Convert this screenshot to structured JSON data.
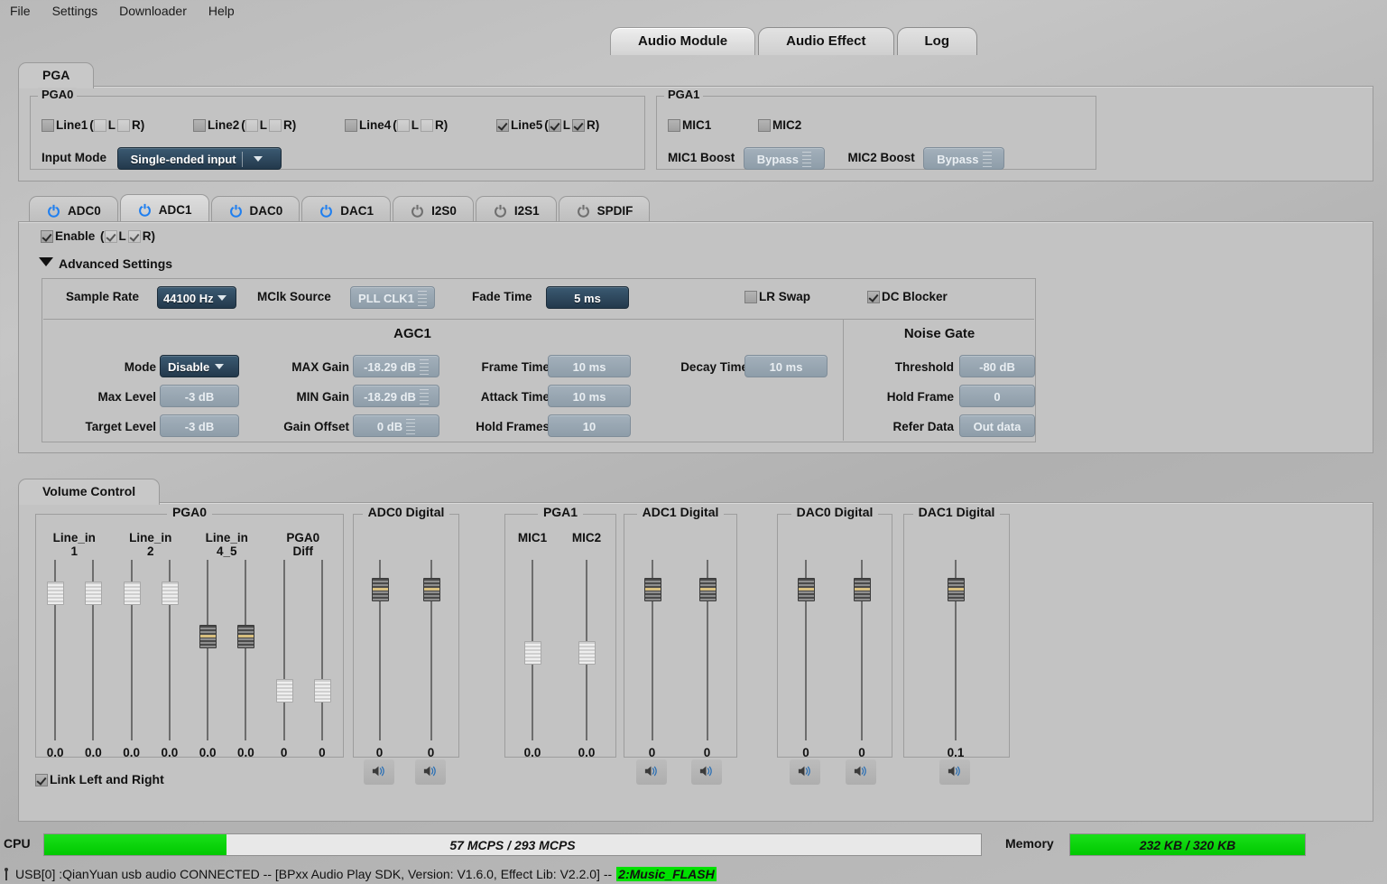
{
  "menubar": {
    "items": [
      "File",
      "Settings",
      "Downloader",
      "Help"
    ]
  },
  "top_tabs": [
    {
      "label": "Audio Module",
      "active": true
    },
    {
      "label": "Audio Effect",
      "active": false
    },
    {
      "label": "Log",
      "active": false
    }
  ],
  "pga_panel": {
    "tab_label": "PGA",
    "pga0": {
      "caption": "PGA0",
      "lines": [
        {
          "label": "Line1",
          "checked": false,
          "enabled": true,
          "l": false,
          "r": false,
          "lr_enabled": false
        },
        {
          "label": "Line2",
          "checked": false,
          "enabled": true,
          "l": false,
          "r": false,
          "lr_enabled": false
        },
        {
          "label": "Line4",
          "checked": false,
          "enabled": true,
          "l": false,
          "r": false,
          "lr_enabled": false
        },
        {
          "label": "Line5",
          "checked": true,
          "enabled": true,
          "l": true,
          "r": true,
          "lr_enabled": true
        }
      ],
      "input_mode_label": "Input Mode",
      "input_mode_value": "Single-ended input"
    },
    "pga1": {
      "caption": "PGA1",
      "mic1_label": "MIC1",
      "mic1_checked": false,
      "mic2_label": "MIC2",
      "mic2_checked": false,
      "mic1_boost_label": "MIC1 Boost",
      "mic1_boost_value": "Bypass",
      "mic2_boost_label": "MIC2 Boost",
      "mic2_boost_value": "Bypass"
    }
  },
  "module_tabs": [
    {
      "label": "ADC0",
      "active": false,
      "power": "on"
    },
    {
      "label": "ADC1",
      "active": true,
      "power": "on"
    },
    {
      "label": "DAC0",
      "active": false,
      "power": "on"
    },
    {
      "label": "DAC1",
      "active": false,
      "power": "on"
    },
    {
      "label": "I2S0",
      "active": false,
      "power": "off"
    },
    {
      "label": "I2S1",
      "active": false,
      "power": "off"
    },
    {
      "label": "SPDIF",
      "active": false,
      "power": "off"
    }
  ],
  "adc1": {
    "enable_label": "Enable",
    "enable_checked": true,
    "l_label": "L",
    "l_checked": true,
    "r_label": "R",
    "r_checked": true,
    "advanced_label": "Advanced Settings",
    "advanced_expanded": true,
    "top_row": {
      "sample_rate_label": "Sample Rate",
      "sample_rate_value": "44100 Hz",
      "mclk_source_label": "MClk Source",
      "mclk_source_value": "PLL CLK1",
      "fade_time_label": "Fade Time",
      "fade_time_value": "5 ms",
      "lr_swap_label": "LR Swap",
      "lr_swap_checked": false,
      "dc_blocker_label": "DC Blocker",
      "dc_blocker_checked": true
    },
    "agc": {
      "title": "AGC1",
      "mode_label": "Mode",
      "mode_value": "Disable",
      "max_level_label": "Max Level",
      "max_level_value": "-3 dB",
      "target_level_label": "Target Level",
      "target_level_value": "-3 dB",
      "max_gain_label": "MAX Gain",
      "max_gain_value": "-18.29 dB",
      "min_gain_label": "MIN Gain",
      "min_gain_value": "-18.29 dB",
      "gain_offset_label": "Gain Offset",
      "gain_offset_value": "0 dB",
      "frame_time_label": "Frame Time",
      "frame_time_value": "10 ms",
      "attack_time_label": "Attack Time",
      "attack_time_value": "10 ms",
      "hold_frames_label": "Hold Frames",
      "hold_frames_value": "10",
      "decay_time_label": "Decay Time",
      "decay_time_value": "10 ms"
    },
    "noise_gate": {
      "title": "Noise Gate",
      "threshold_label": "Threshold",
      "threshold_value": "-80 dB",
      "hold_frame_label": "Hold Frame",
      "hold_frame_value": "0",
      "refer_data_label": "Refer  Data",
      "refer_data_value": "Out data"
    }
  },
  "volume_control": {
    "tab_label": "Volume Control",
    "link_label": "Link Left and Right",
    "link_checked": true,
    "groups": [
      {
        "title": "PGA0",
        "channels": [
          "Line_in 1",
          "Line_in 2",
          "Line_in 4_5",
          "PGA0 Diff"
        ],
        "sliders": [
          {
            "value": "0.0",
            "enabled": false,
            "pos_pct": 12
          },
          {
            "value": "0.0",
            "enabled": false,
            "pos_pct": 12
          },
          {
            "value": "0.0",
            "enabled": false,
            "pos_pct": 12
          },
          {
            "value": "0.0",
            "enabled": false,
            "pos_pct": 12
          },
          {
            "value": "0.0",
            "enabled": true,
            "pos_pct": 36
          },
          {
            "value": "0.0",
            "enabled": true,
            "pos_pct": 36
          },
          {
            "value": "0",
            "enabled": false,
            "pos_pct": 66
          },
          {
            "value": "0",
            "enabled": false,
            "pos_pct": 66
          }
        ],
        "mute_buttons": 0
      },
      {
        "title": "ADC0 Digital",
        "channels": [],
        "sliders": [
          {
            "value": "0",
            "enabled": true,
            "pos_pct": 10
          },
          {
            "value": "0",
            "enabled": true,
            "pos_pct": 10
          }
        ],
        "mute_buttons": 2
      },
      {
        "title": "PGA1",
        "channels": [
          "MIC1",
          "MIC2"
        ],
        "sliders": [
          {
            "value": "0.0",
            "enabled": false,
            "pos_pct": 45
          },
          {
            "value": "0.0",
            "enabled": false,
            "pos_pct": 45
          }
        ],
        "mute_buttons": 0
      },
      {
        "title": "ADC1 Digital",
        "channels": [],
        "sliders": [
          {
            "value": "0",
            "enabled": true,
            "pos_pct": 10
          },
          {
            "value": "0",
            "enabled": true,
            "pos_pct": 10
          }
        ],
        "mute_buttons": 2
      },
      {
        "title": "DAC0 Digital",
        "channels": [],
        "sliders": [
          {
            "value": "0",
            "enabled": true,
            "pos_pct": 10
          },
          {
            "value": "0",
            "enabled": true,
            "pos_pct": 10
          }
        ],
        "mute_buttons": 2
      },
      {
        "title": "DAC1 Digital",
        "channels": [],
        "sliders": [
          {
            "value": "0.1",
            "enabled": true,
            "pos_pct": 10
          }
        ],
        "mute_buttons": 1
      }
    ]
  },
  "footer": {
    "cpu_label": "CPU",
    "cpu_value": "57 MCPS / 293 MCPS",
    "cpu_percent": 19.5,
    "memory_label": "Memory",
    "memory_value": "232 KB / 320 KB",
    "memory_percent": 100,
    "status_text": "USB[0] :QianYuan usb audio CONNECTED -- [BPxx Audio Play SDK,  Version: V1.6.0,  Effect Lib: V2.2.0] --",
    "status_highlight": "2:Music_FLASH"
  },
  "colors": {
    "accent_active_field": "#2d4557",
    "readonly_field": "#97a5b1",
    "power_on": "#1f7ff0",
    "power_off": "#6f6f6f",
    "meter_green": "#00d200",
    "background": "#bdbdbd"
  }
}
